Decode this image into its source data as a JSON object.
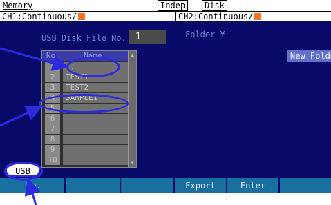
{
  "header": {
    "memory_label": "Memory",
    "indep_label": "Indep",
    "disk_label": "Disk",
    "ch1_label": "CH1:Continuous/",
    "ch2_label": "CH2:Continuous/"
  },
  "main": {
    "title": "USB Disk File No.",
    "file_number": "1",
    "folder": "Folder ¥",
    "new_folder_button": "New Folde"
  },
  "file_list": {
    "col_no": "No.",
    "col_name": "Name",
    "rows": [
      {
        "no": "1",
        "name": ".."
      },
      {
        "no": "2",
        "name": "TEST1"
      },
      {
        "no": "3",
        "name": "TEST2"
      },
      {
        "no": "4",
        "name": "SAMPLE1"
      },
      {
        "no": "5",
        "name": ""
      },
      {
        "no": "6",
        "name": ""
      },
      {
        "no": "7",
        "name": ""
      },
      {
        "no": "8",
        "name": ""
      },
      {
        "no": "9",
        "name": ""
      },
      {
        "no": "10",
        "name": ""
      }
    ]
  },
  "usb_tab": "USB",
  "softkeys": [
    "No.",
    "",
    "",
    "Export",
    "Enter",
    ""
  ],
  "colors": {
    "screen_bg": "#09096a",
    "softkey": "#1870a0",
    "highlight": "#f07820",
    "callout": "#2a2adf"
  }
}
